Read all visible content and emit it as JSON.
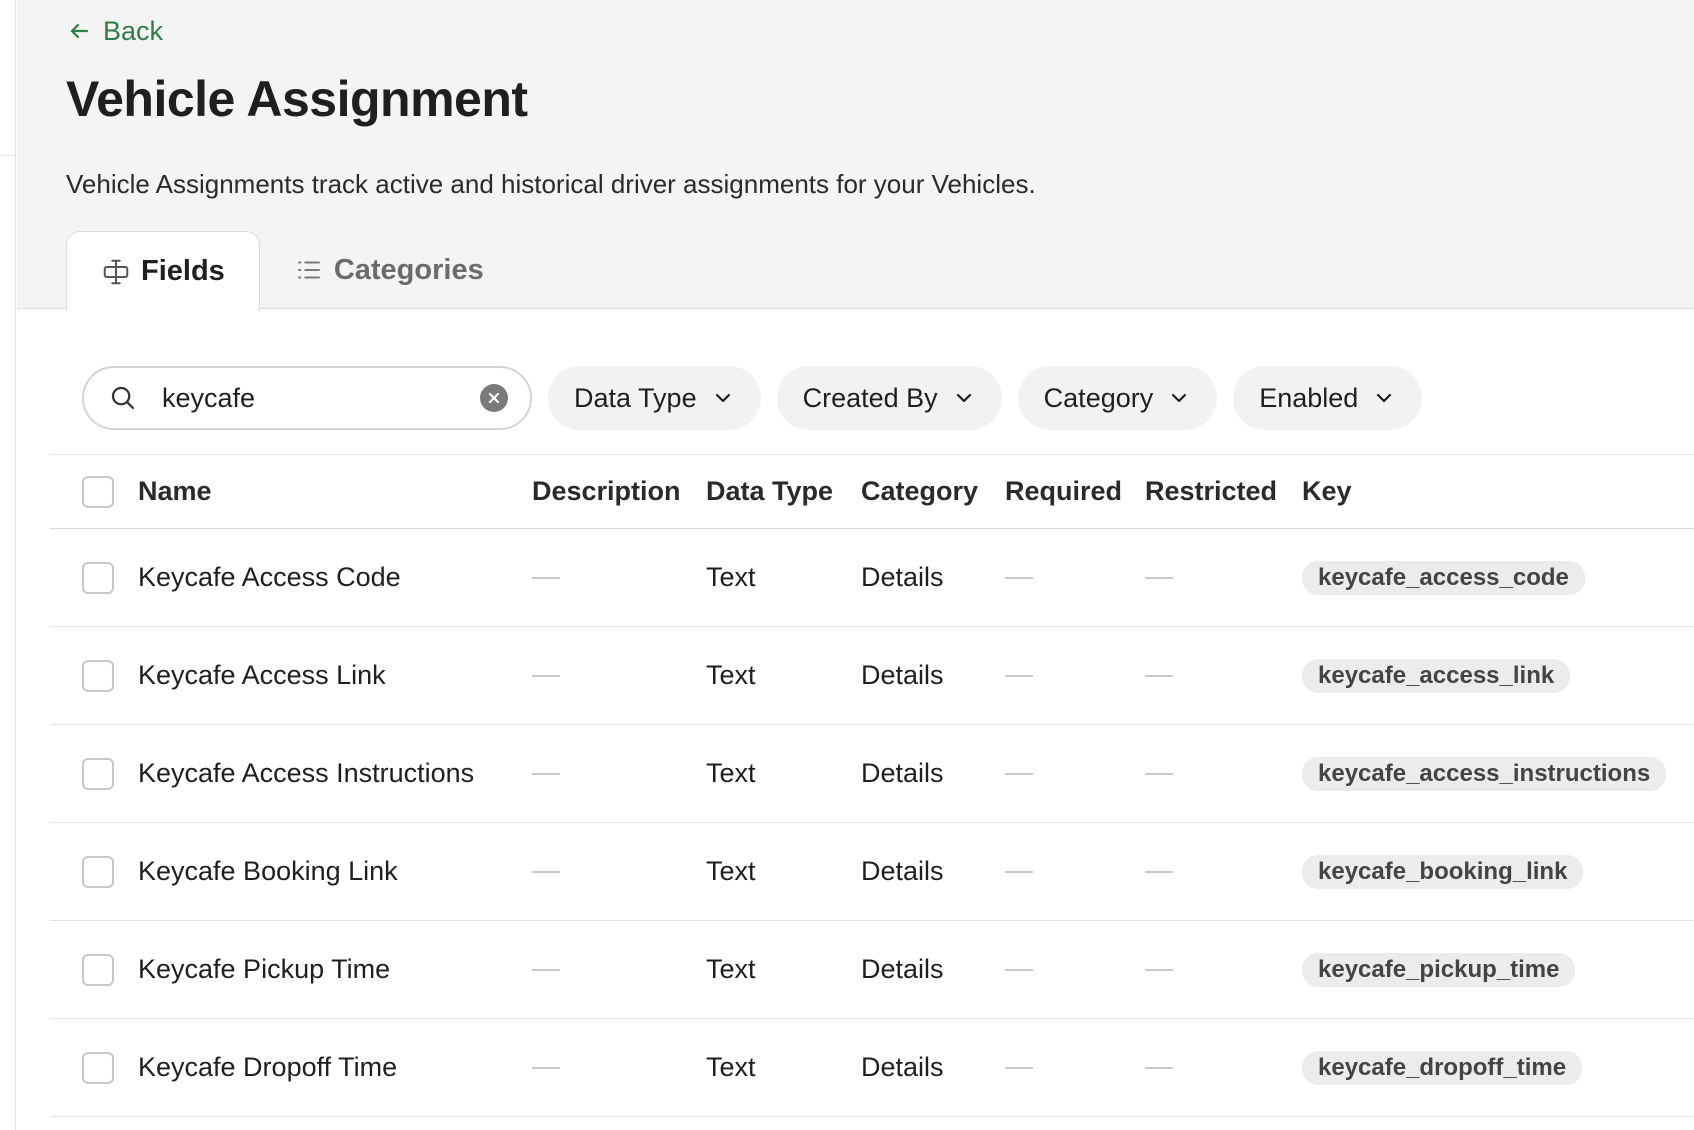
{
  "nav": {
    "back_label": "Back"
  },
  "page": {
    "title": "Vehicle Assignment",
    "description": "Vehicle Assignments track active and historical driver assignments for your Vehicles."
  },
  "tabs": [
    {
      "label": "Fields",
      "icon": "field-icon",
      "active": true
    },
    {
      "label": "Categories",
      "icon": "list-icon",
      "active": false
    }
  ],
  "search": {
    "value": "keycafe",
    "placeholder": "Search"
  },
  "filters": [
    "Data Type",
    "Created By",
    "Category",
    "Enabled"
  ],
  "table": {
    "columns": [
      "Name",
      "Description",
      "Data Type",
      "Category",
      "Required",
      "Restricted",
      "Key"
    ],
    "rows": [
      {
        "name": "Keycafe Access Code",
        "description": "—",
        "data_type": "Text",
        "category": "Details",
        "required": "—",
        "restricted": "—",
        "key": "keycafe_access_code"
      },
      {
        "name": "Keycafe Access Link",
        "description": "—",
        "data_type": "Text",
        "category": "Details",
        "required": "—",
        "restricted": "—",
        "key": "keycafe_access_link"
      },
      {
        "name": "Keycafe Access Instructions",
        "description": "—",
        "data_type": "Text",
        "category": "Details",
        "required": "—",
        "restricted": "—",
        "key": "keycafe_access_instructions"
      },
      {
        "name": "Keycafe Booking Link",
        "description": "—",
        "data_type": "Text",
        "category": "Details",
        "required": "—",
        "restricted": "—",
        "key": "keycafe_booking_link"
      },
      {
        "name": "Keycafe Pickup Time",
        "description": "—",
        "data_type": "Text",
        "category": "Details",
        "required": "—",
        "restricted": "—",
        "key": "keycafe_pickup_time"
      },
      {
        "name": "Keycafe Dropoff Time",
        "description": "—",
        "data_type": "Text",
        "category": "Details",
        "required": "—",
        "restricted": "—",
        "key": "keycafe_dropoff_time"
      }
    ]
  },
  "colors": {
    "accent_green": "#2e7d46",
    "header_bg": "#f4f4f4",
    "pill_bg": "#f2f2f2"
  }
}
